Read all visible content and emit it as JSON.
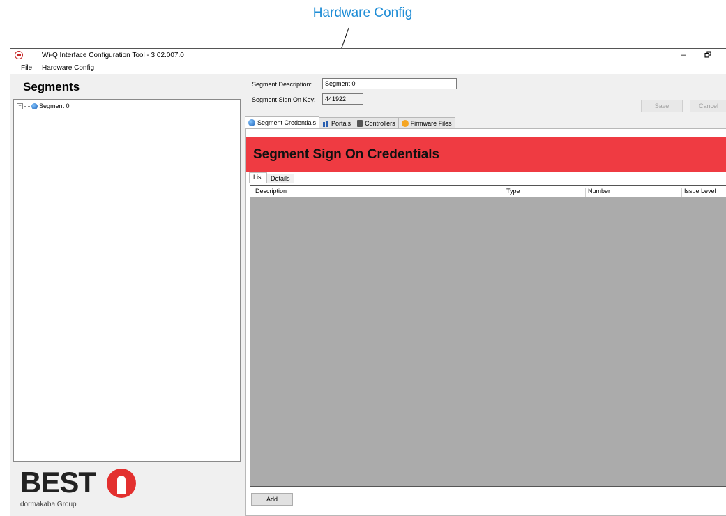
{
  "callout": {
    "label": "Hardware Config"
  },
  "window": {
    "title": "Wi-Q Interface Configuration Tool - 3.02.007.0",
    "minimize": "–",
    "restore": "🗗"
  },
  "menu": {
    "file": "File",
    "hardware_config": "Hardware Config"
  },
  "sidebar": {
    "title": "Segments",
    "tree": [
      {
        "label": "Segment 0",
        "expander": "+"
      }
    ],
    "logo": {
      "brand": "BEST",
      "sub": "dormakaba Group"
    }
  },
  "form": {
    "description_label": "Segment Description:",
    "description_value": "Segment 0",
    "signon_label": "Segment Sign On Key:",
    "signon_value": "441922",
    "save": "Save",
    "cancel": "Cancel"
  },
  "tabs": {
    "credentials": "Segment Credentials",
    "portals": "Portals",
    "controllers": "Controllers",
    "firmware": "Firmware Files"
  },
  "banner": {
    "title": "Segment Sign On Credentials"
  },
  "subtabs": {
    "list": "List",
    "details": "Details"
  },
  "grid": {
    "columns": [
      "Description",
      "Type",
      "Number",
      "Issue Level"
    ]
  },
  "add_button": "Add",
  "colors": {
    "banner": "#ef3b42",
    "callout": "#1f8dd6",
    "grid_bg": "#ababab"
  }
}
